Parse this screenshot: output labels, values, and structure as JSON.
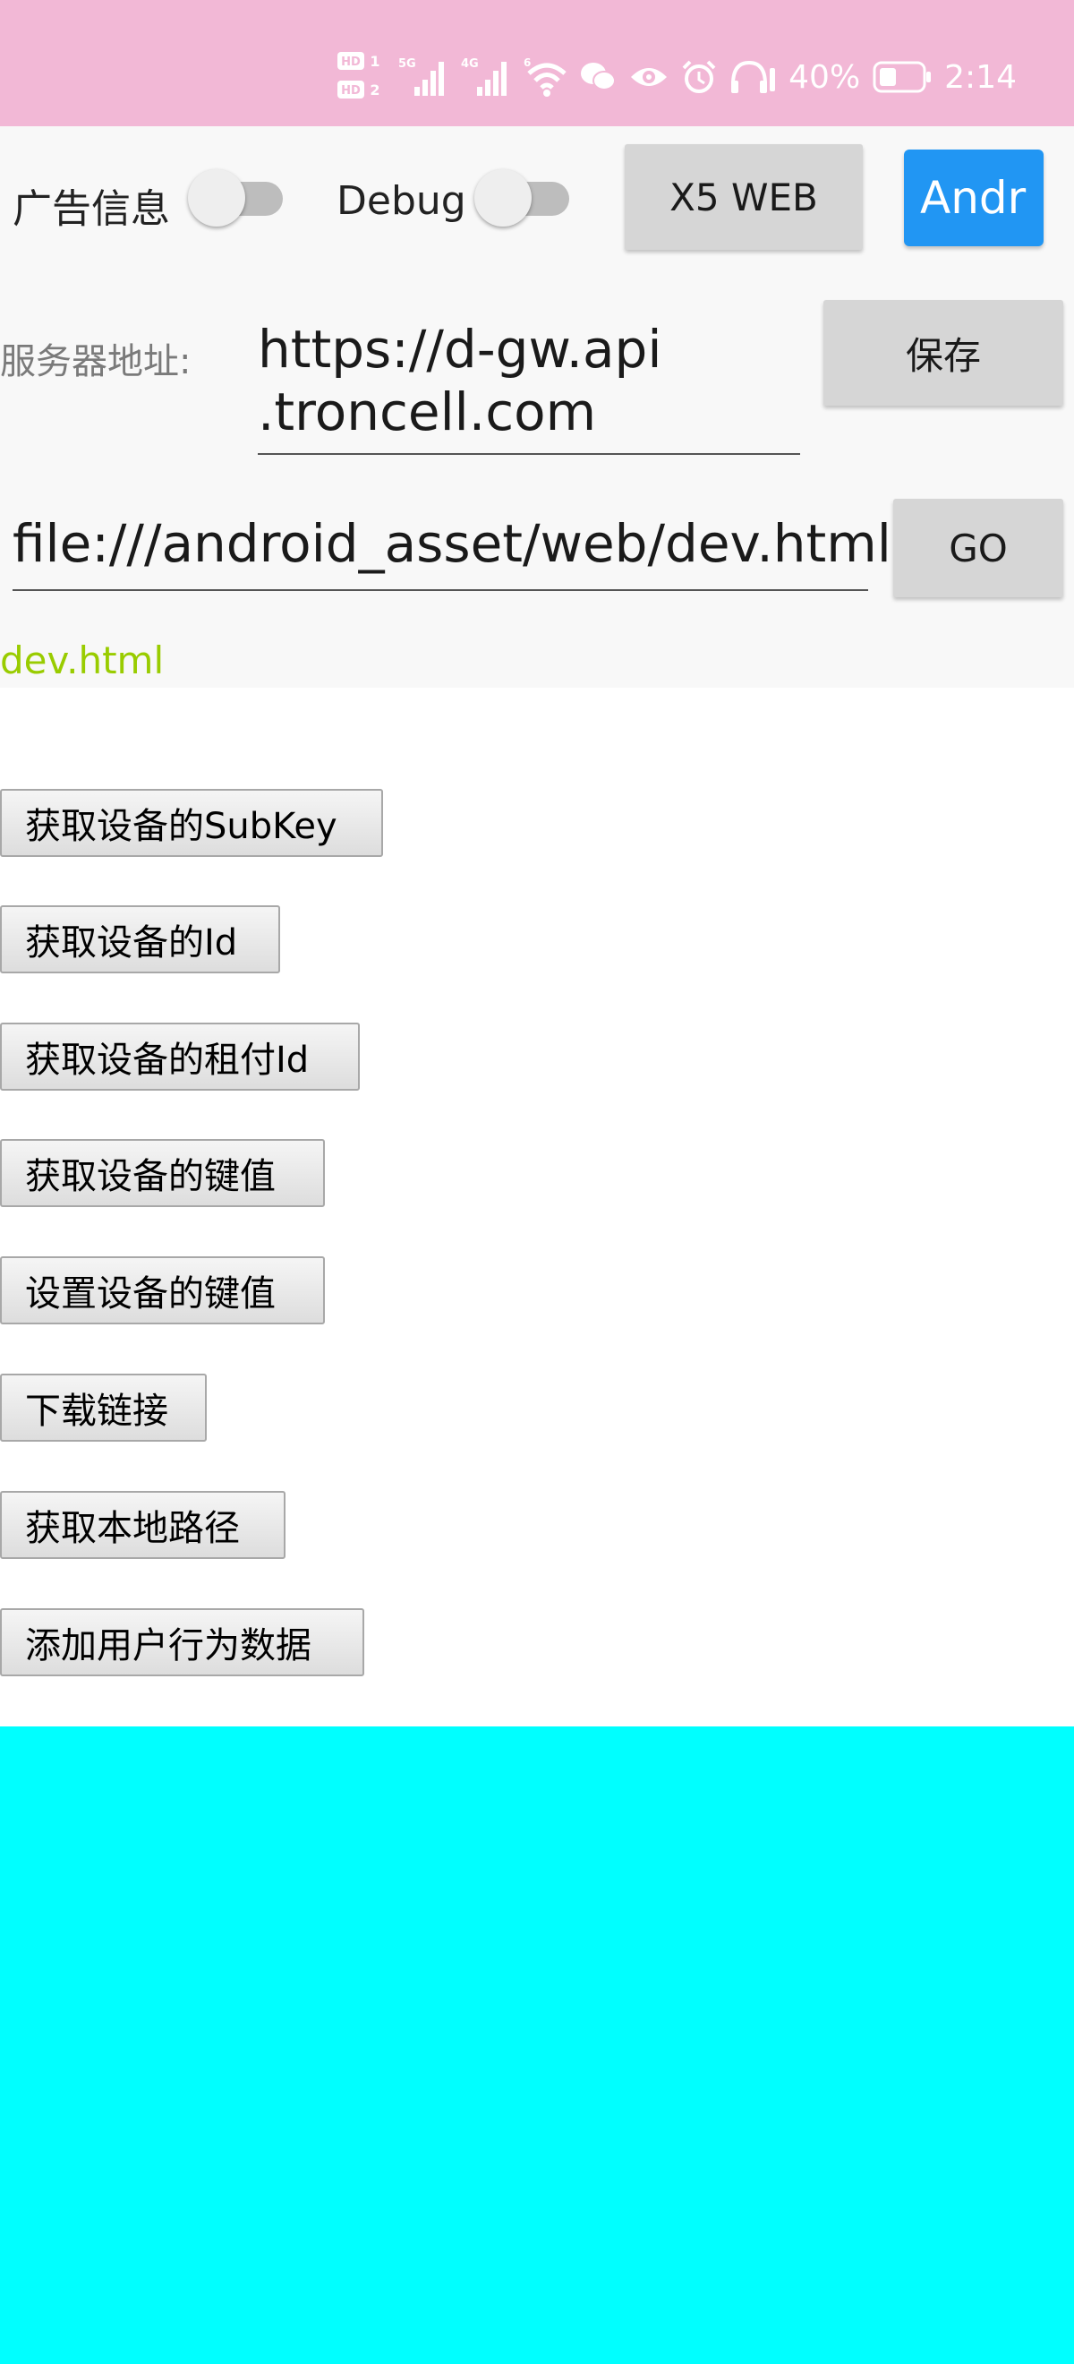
{
  "status_bar": {
    "battery_percent": "40%",
    "time": "2:14",
    "background_color": "#f2b8d6",
    "icons": [
      "hd-sim1-icon",
      "hd-sim2-icon",
      "5g-signal-icon",
      "4g-signal-icon",
      "wifi-icon",
      "wechat-icon",
      "eye-icon",
      "alarm-icon",
      "headphones-icon",
      "battery-icon"
    ]
  },
  "controls": {
    "ad_info_label": "广告信息",
    "ad_info_on": false,
    "debug_label": "Debug",
    "debug_on": false,
    "x5_web_label": "X5 WEB",
    "android_label": "Andr",
    "accent_color": "#2196f3"
  },
  "server": {
    "label": "服务器地址:",
    "value_line1": "https://d-gw.api",
    "value_line2": ".troncell.com",
    "save_label": "保存"
  },
  "url": {
    "value": "file:///android_asset/web/dev.html",
    "go_label": "GO",
    "page_name": "dev.html",
    "page_name_color": "#99cc00"
  },
  "web": {
    "buttons": [
      "获取设备的SubKey",
      "获取设备的Id",
      "获取设备的租付Id",
      "获取设备的键值",
      "设置设备的键值",
      "下载链接",
      "获取本地路径",
      "添加用户行为数据"
    ],
    "bottom_color": "#00ffff"
  }
}
